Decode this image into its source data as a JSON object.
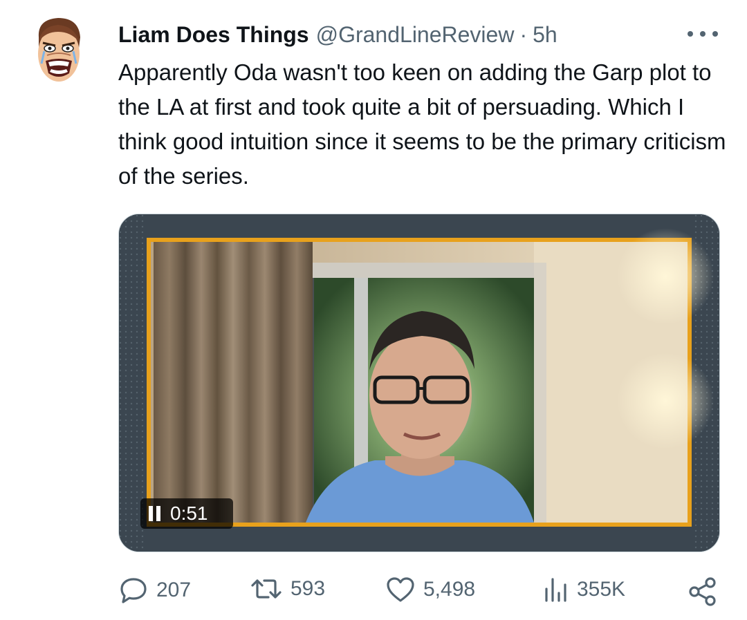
{
  "tweet": {
    "author_name": "Liam Does Things",
    "author_handle": "@GrandLineReview",
    "separator": "·",
    "timestamp": "5h",
    "text": "Apparently Oda wasn't too keen on adding the Garp plot to the LA at first and took quite a bit of persuading. Which I think good intuition since it seems to be the primary criticism of the series."
  },
  "video": {
    "elapsed": "0:51",
    "state": "playing"
  },
  "actions": {
    "replies": "207",
    "reposts": "593",
    "likes": "5,498",
    "views": "355K"
  },
  "icons": {
    "more": "more-icon",
    "reply": "reply-icon",
    "repost": "repost-icon",
    "like": "heart-icon",
    "views": "views-icon",
    "share": "share-icon",
    "pause": "pause-icon"
  },
  "colors": {
    "text_primary": "#0f1419",
    "text_secondary": "#536471",
    "video_frame": "#e8a11c"
  }
}
